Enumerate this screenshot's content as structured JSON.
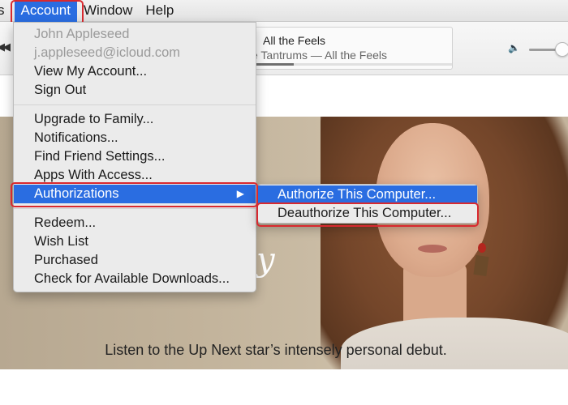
{
  "menubar": {
    "items": [
      {
        "label": "s",
        "state": "normal"
      },
      {
        "label": "Account",
        "state": "active"
      },
      {
        "label": "Window",
        "state": "normal"
      },
      {
        "label": "Help",
        "state": "normal"
      }
    ]
  },
  "player": {
    "controls_icon": "rewind-play-icon",
    "song_title": "All the Feels",
    "song_artist": "e Tantrums — All the Feels",
    "progress_fraction": 0.24,
    "volume_icon": "speaker-icon"
  },
  "account_menu": {
    "user_name": "John Appleseed",
    "user_email": "j.appleseed@icloud.com",
    "view_account": "View My Account...",
    "sign_out": "Sign Out",
    "upgrade_family": "Upgrade to Family...",
    "notifications": "Notifications...",
    "find_friend": "Find Friend Settings...",
    "apps_access": "Apps With Access...",
    "authorizations": "Authorizations",
    "authorizations_arrow": "▶",
    "redeem": "Redeem...",
    "wish_list": "Wish List",
    "purchased": "Purchased",
    "check_downloads": "Check for Available Downloads..."
  },
  "authorizations_submenu": {
    "authorize": "Authorize This Computer...",
    "deauthorize": "Deauthorize This Computer..."
  },
  "hero": {
    "script_text": "y",
    "tagline": "Listen to the Up Next star’s intensely personal debut."
  },
  "colors": {
    "menu_highlight": "#2a6de1",
    "annotation_red": "#d8292f",
    "menu_background": "#ebebeb"
  }
}
